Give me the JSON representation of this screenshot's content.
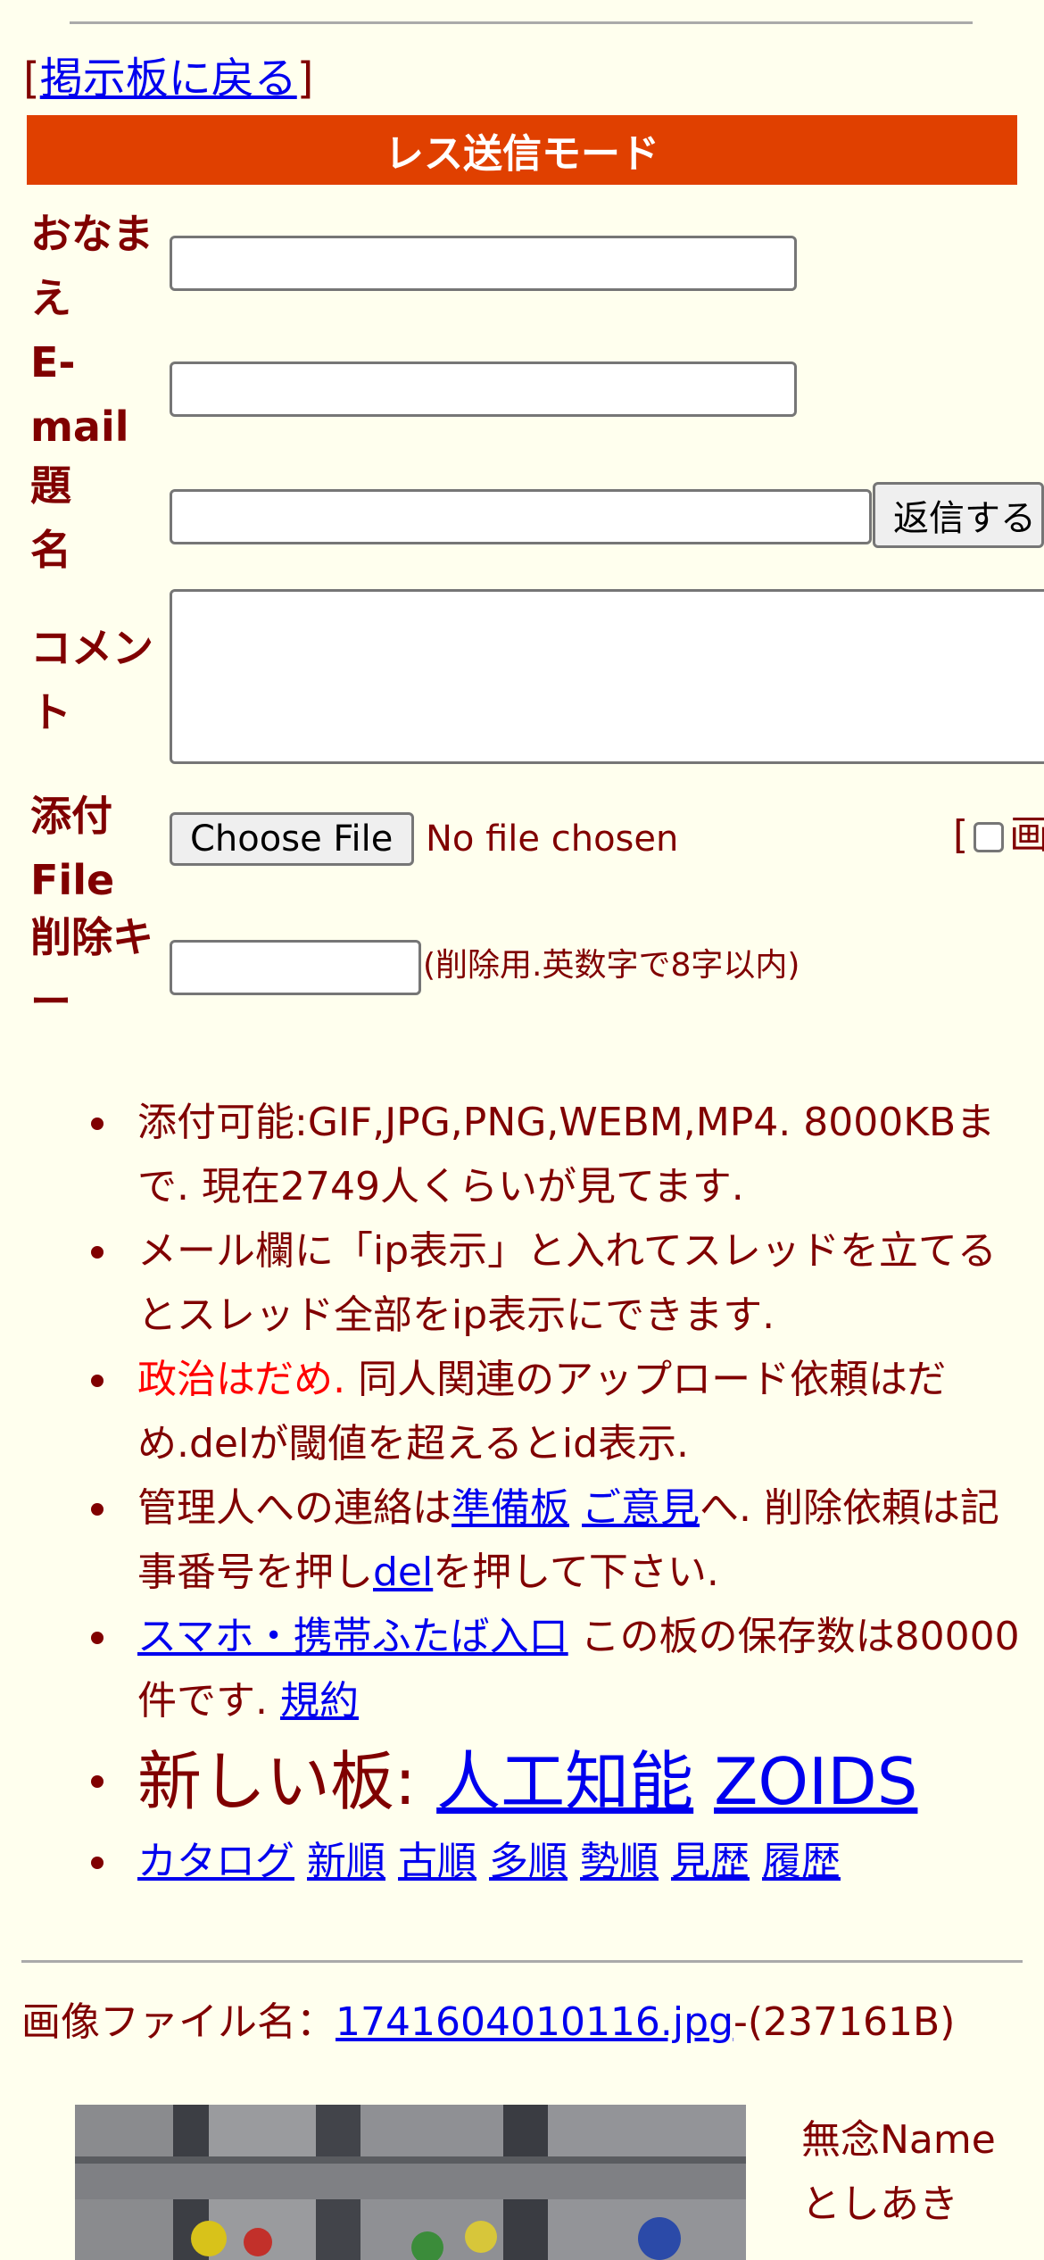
{
  "nav": {
    "back_prefix": "[",
    "back_label": "掲示板に戻る",
    "back_suffix": "]"
  },
  "form": {
    "mode_title": "レス送信モード",
    "name_label": "おなまえ",
    "email_label": "E-mail",
    "subject_label": "題名",
    "submit_label": "返信する",
    "comment_label": "コメント",
    "attach_label": "添付File",
    "choose_file_label": "Choose File",
    "no_file_text": "No file chosen",
    "attach_option_bracket": "[",
    "attach_option_text": "画",
    "delkey_label": "削除キー",
    "delkey_hint": "(削除用.英数字で8字以内)"
  },
  "rules": {
    "r1": "添付可能:GIF,JPG,PNG,WEBM,MP4. 8000KBまで. 現在2749人くらいが見てます.",
    "r2": "メール欄に「ip表示」と入れてスレッドを立てるとスレッド全部をip表示にできます.",
    "r3_red": "政治はだめ.",
    "r3_rest": " 同人関連のアップロード依頼はだめ.delが閾値を超えるとid表示.",
    "r4_pre": "管理人への連絡は",
    "r4_link1": "準備板",
    "r4_link2": "ご意見",
    "r4_mid": "へ. 削除依頼は記事番号を押し",
    "r4_link3": "del",
    "r4_post": "を押して下さい.",
    "r5_link": "スマホ・携帯ふたば入口",
    "r5_text": " この板の保存数は80000件です. ",
    "r5_link2": "規約",
    "new_board_label": "新しい板: ",
    "new_board_1": "人工知能",
    "new_board_2": "ZOIDS",
    "links": [
      "カタログ",
      "新順",
      "古順",
      "多順",
      "勢順",
      "見歴",
      "履歴"
    ]
  },
  "post": {
    "file_prefix": "画像ファイル名：",
    "file_name": "1741604010116.jpg",
    "file_size": "-(237161B)",
    "name_line1": "無念Name",
    "name_line2": "としあき"
  },
  "colors": {
    "accent": "#e04000",
    "text": "#800000",
    "background": "#ffffee",
    "link": "#0000ee",
    "warning": "#ff0000"
  }
}
